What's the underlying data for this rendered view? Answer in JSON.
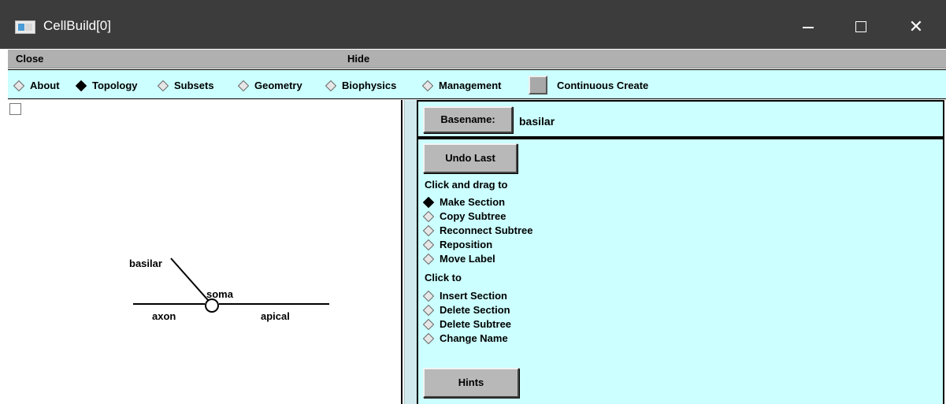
{
  "window": {
    "title": "CellBuild[0]",
    "minimize_glyph": "—",
    "maximize_glyph": "☐",
    "close_glyph": "✕"
  },
  "menubar": {
    "close_label": "Close",
    "hide_label": "Hide"
  },
  "tabs": [
    {
      "label": "About",
      "selected": false
    },
    {
      "label": "Topology",
      "selected": true
    },
    {
      "label": "Subsets",
      "selected": false
    },
    {
      "label": "Geometry",
      "selected": false
    },
    {
      "label": "Biophysics",
      "selected": false
    },
    {
      "label": "Management",
      "selected": false
    }
  ],
  "continuous_create": {
    "label": "Continuous Create",
    "checked": false
  },
  "canvas": {
    "labels": {
      "basilar": "basilar",
      "soma": "soma",
      "axon": "axon",
      "apical": "apical"
    }
  },
  "basename": {
    "button_label": "Basename:",
    "value": "basilar"
  },
  "tools": {
    "undo_label": "Undo Last",
    "drag_heading": "Click and drag to",
    "drag_options": [
      {
        "label": "Make Section",
        "selected": true
      },
      {
        "label": "Copy Subtree",
        "selected": false
      },
      {
        "label": "Reconnect Subtree",
        "selected": false
      },
      {
        "label": "Reposition",
        "selected": false
      },
      {
        "label": "Move Label",
        "selected": false
      }
    ],
    "click_heading": "Click to",
    "click_options": [
      {
        "label": "Insert Section",
        "selected": false
      },
      {
        "label": "Delete Section",
        "selected": false
      },
      {
        "label": "Delete Subtree",
        "selected": false
      },
      {
        "label": "Change Name",
        "selected": false
      }
    ],
    "hints_label": "Hints"
  },
  "colors": {
    "panel_bg": "#ccffff",
    "titlebar_bg": "#3c3c3c",
    "menubar_bg": "#b0b0b0",
    "button_bg": "#b8b8b8"
  }
}
